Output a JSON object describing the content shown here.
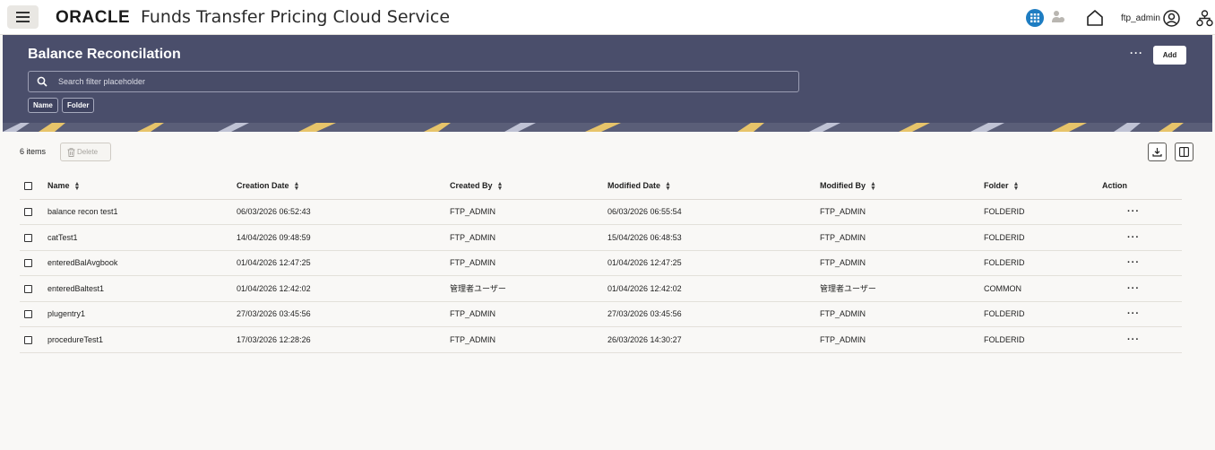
{
  "header": {
    "logo": "ORACLE",
    "app_title": "Funds Transfer Pricing Cloud Service",
    "username": "ftp_admin",
    "icons": [
      "hamburger-menu-icon",
      "grid-icon",
      "person-icon",
      "home-icon",
      "user-avatar-icon",
      "org-chart-icon"
    ]
  },
  "banner": {
    "title": "Balance Reconcilation",
    "search_placeholder": "Search filter placeholder",
    "chips": [
      "Name",
      "Folder"
    ],
    "more_label": "···",
    "add_label": "Add"
  },
  "toolbar": {
    "items_count": "6 items",
    "delete_label": "Delete"
  },
  "table": {
    "columns": [
      "Name",
      "Creation Date",
      "Created By",
      "Modified Date",
      "Modified By",
      "Folder",
      "Action"
    ],
    "rows": [
      {
        "name": "balance recon test1",
        "creation_date": "06/03/2026 06:52:43",
        "created_by": "FTP_ADMIN",
        "modified_date": "06/03/2026 06:55:54",
        "modified_by": "FTP_ADMIN",
        "folder": "FOLDERID",
        "action": "···"
      },
      {
        "name": "catTest1",
        "creation_date": "14/04/2026 09:48:59",
        "created_by": "FTP_ADMIN",
        "modified_date": "15/04/2026 06:48:53",
        "modified_by": "FTP_ADMIN",
        "folder": "FOLDERID",
        "action": "···"
      },
      {
        "name": "enteredBalAvgbook",
        "creation_date": "01/04/2026 12:47:25",
        "created_by": "FTP_ADMIN",
        "modified_date": "01/04/2026 12:47:25",
        "modified_by": "FTP_ADMIN",
        "folder": "FOLDERID",
        "action": "···"
      },
      {
        "name": "enteredBaltest1",
        "creation_date": "01/04/2026 12:42:02",
        "created_by": "管理者ユーザー",
        "modified_date": "01/04/2026 12:42:02",
        "modified_by": "管理者ユーザー",
        "folder": "COMMON",
        "action": "···"
      },
      {
        "name": "plugentry1",
        "creation_date": "27/03/2026 03:45:56",
        "created_by": "FTP_ADMIN",
        "modified_date": "27/03/2026 03:45:56",
        "modified_by": "FTP_ADMIN",
        "folder": "FOLDERID",
        "action": "···"
      },
      {
        "name": "procedureTest1",
        "creation_date": "17/03/2026 12:28:26",
        "created_by": "FTP_ADMIN",
        "modified_date": "26/03/2026 14:30:27",
        "modified_by": "FTP_ADMIN",
        "folder": "FOLDERID",
        "action": "···"
      }
    ]
  },
  "colors": {
    "banner_bg": "#4a4e6b",
    "accent_blue": "#1e7dc2",
    "page_bg": "#f9f8f6"
  }
}
